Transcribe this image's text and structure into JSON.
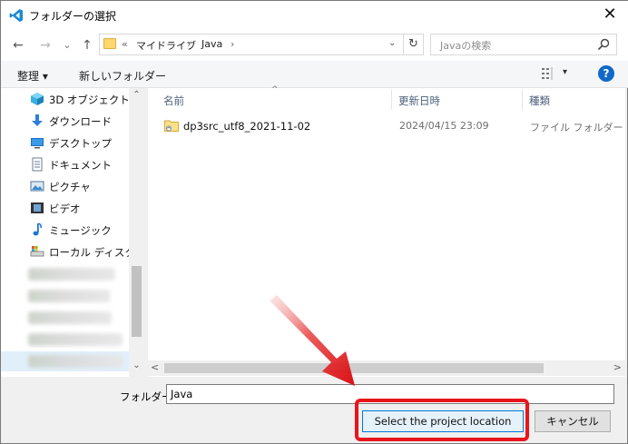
{
  "window": {
    "title": "フォルダーの選択",
    "close_glyph": "✕"
  },
  "nav_buttons": {
    "back": "←",
    "forward": "→",
    "recent": "⌄",
    "up": "↑"
  },
  "address": {
    "prefix": "«",
    "crumbs": [
      "マイドライブ",
      "Java"
    ],
    "separators": [
      "›",
      "›"
    ],
    "dropdown": "⌄",
    "refresh": "↻"
  },
  "search": {
    "placeholder": "Javaの検索"
  },
  "toolbar": {
    "organize": "整理 ▾",
    "new_folder": "新しいフォルダー",
    "view_dropdown": "▾",
    "help": "?"
  },
  "nav_pane": {
    "items": [
      {
        "label": "3D オブジェクト",
        "icon": "3d-objects-icon"
      },
      {
        "label": "ダウンロード",
        "icon": "download-icon"
      },
      {
        "label": "デスクトップ",
        "icon": "desktop-icon"
      },
      {
        "label": "ドキュメント",
        "icon": "documents-icon"
      },
      {
        "label": "ピクチャ",
        "icon": "pictures-icon"
      },
      {
        "label": "ビデオ",
        "icon": "videos-icon"
      },
      {
        "label": "ミュージック",
        "icon": "music-icon"
      },
      {
        "label": "ローカル ディスク (C",
        "icon": "local-disk-icon"
      }
    ],
    "scroll_up": "⌃",
    "scroll_down": "⌄"
  },
  "file_list": {
    "columns": [
      "名前",
      "更新日時",
      "種類"
    ],
    "sort_indicator": "^",
    "rows": [
      {
        "name": "dp3src_utf8_2021-11-02",
        "modified": "2024/04/15 23:09",
        "type": "ファイル フォルダー"
      }
    ],
    "scroll_left": "<",
    "scroll_right": ">"
  },
  "footer": {
    "folder_label": "フォルダー:",
    "folder_value": "Java",
    "select_button": "Select the project location",
    "cancel_button": "キャンセル"
  },
  "colors": {
    "highlight": "#e8151b",
    "primary_border": "#0078d7",
    "help_blue": "#1168c9"
  }
}
